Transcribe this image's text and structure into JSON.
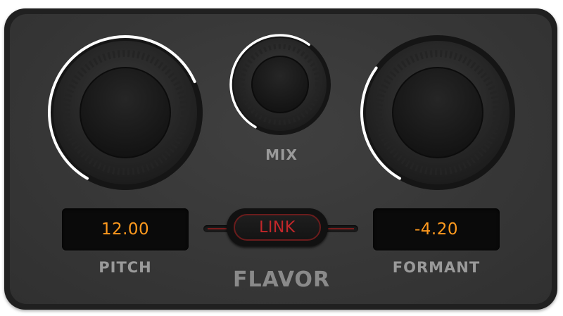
{
  "knobs": {
    "pitch": {
      "value_fraction": 0.72
    },
    "mix": {
      "value_fraction": 0.62
    },
    "formant": {
      "value_fraction": 0.32
    }
  },
  "labels": {
    "mix": "MIX",
    "pitch": "PITCH",
    "formant": "FORMANT",
    "plugin": "FLAVOR"
  },
  "displays": {
    "pitch_value": "12.00",
    "formant_value": "-4.20"
  },
  "link_button": {
    "label": "LINK"
  },
  "colors": {
    "display_text": "#ff9a1e",
    "link_text": "#c2272a",
    "indicator_arc": "#ffffff"
  }
}
